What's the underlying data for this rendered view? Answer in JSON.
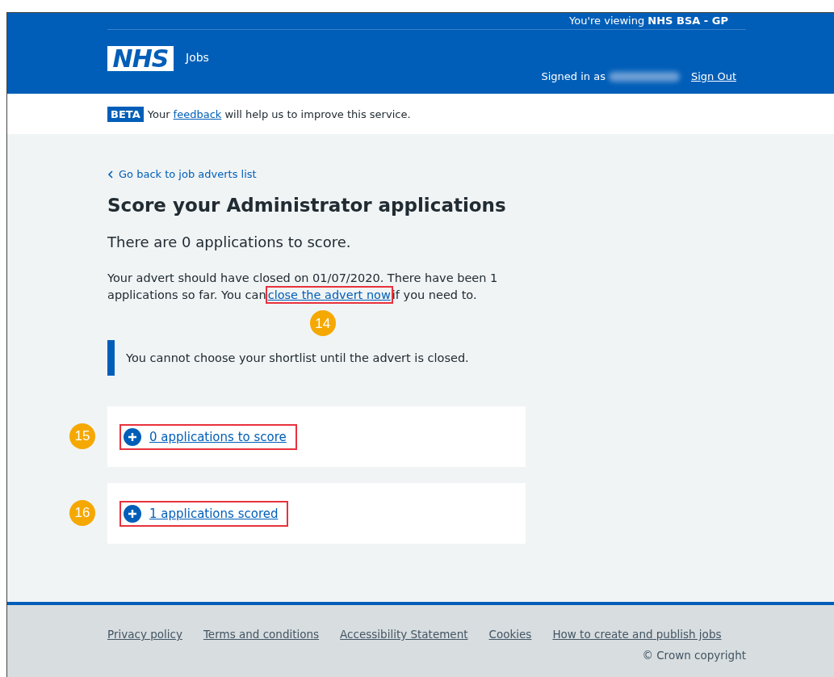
{
  "header": {
    "viewing_prefix": "You're viewing",
    "viewing_org": "NHS BSA - GP",
    "logo": "NHS",
    "service": "Jobs",
    "signed_in_label": "Signed in as",
    "sign_out": "Sign Out"
  },
  "beta": {
    "tag": "BETA",
    "before": "Your",
    "link": "feedback",
    "after": "will help us to improve this service."
  },
  "back_link": "Go back to job adverts list",
  "title": "Score your Administrator applications",
  "lead": "There are 0 applications to score.",
  "notice": {
    "before": "Your advert should have closed on 01/07/2020. There have been 1 applications so far. You can",
    "link": "close the advert now",
    "after": "if you need to.",
    "callout": "14"
  },
  "inset": "You cannot choose your shortlist until the advert is closed.",
  "sections": [
    {
      "label": "0 applications to score",
      "expanded": false,
      "callout": "15"
    },
    {
      "label": "1 applications scored",
      "expanded": false,
      "callout": "16"
    }
  ],
  "footer": {
    "links": [
      "Privacy policy",
      "Terms and conditions",
      "Accessibility Statement",
      "Cookies",
      "How to create and publish jobs"
    ],
    "copyright": "© Crown copyright"
  }
}
